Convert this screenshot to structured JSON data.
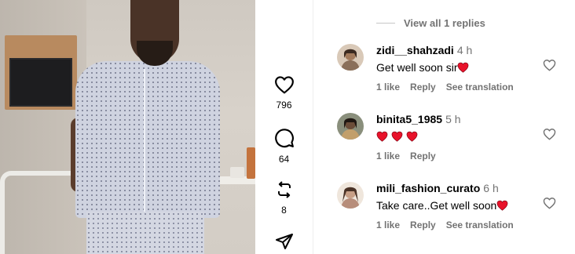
{
  "video": {
    "actions": [
      {
        "icon": "heart-icon",
        "count": "796"
      },
      {
        "icon": "comment-icon",
        "count": "64"
      },
      {
        "icon": "repost-icon",
        "count": "8"
      },
      {
        "icon": "send-icon",
        "count": ""
      }
    ]
  },
  "comments": {
    "view_replies": "View all 1 replies",
    "items": [
      {
        "username": "zidi__shahzadi",
        "time": "4 h",
        "text": "Get well soon sir",
        "emoji": "red-heart",
        "emoji_count": 1,
        "likes": "1 like",
        "reply": "Reply",
        "translate": "See translation"
      },
      {
        "username": "binita5_1985",
        "time": "5 h",
        "text": "",
        "emoji": "red-heart",
        "emoji_count": 3,
        "likes": "1 like",
        "reply": "Reply",
        "translate": ""
      },
      {
        "username": "mili_fashion_curato",
        "time": "6 h",
        "text": "Take care..Get well soon",
        "emoji": "red-heart",
        "emoji_count": 1,
        "likes": "1 like",
        "reply": "Reply",
        "translate": "See translation"
      }
    ]
  },
  "colors": {
    "heart_red": "#e8132b",
    "muted_text": "#737373"
  }
}
